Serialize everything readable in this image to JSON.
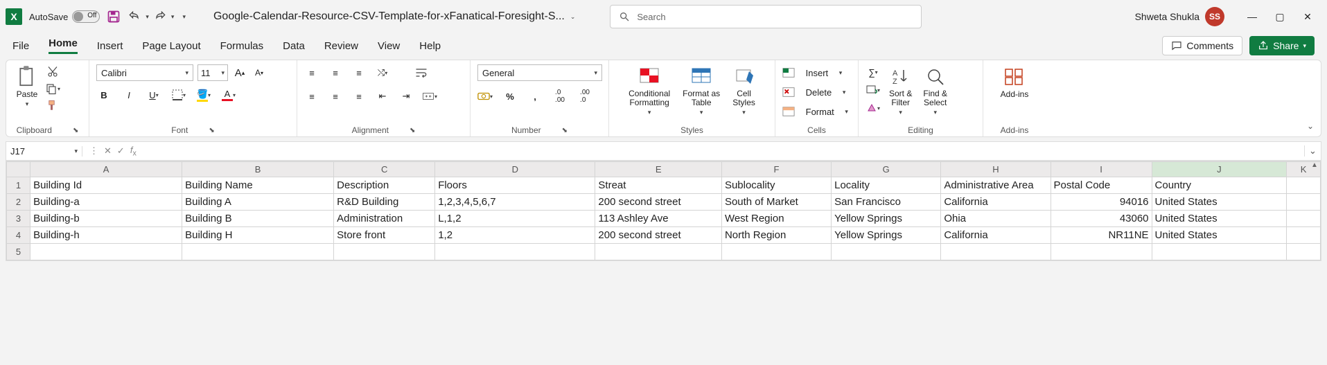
{
  "titlebar": {
    "autosave_label": "AutoSave",
    "autosave_state": "Off",
    "doc_title": "Google-Calendar-Resource-CSV-Template-for-xFanatical-Foresight-S...",
    "search_placeholder": "Search",
    "user_name": "Shweta Shukla",
    "user_initials": "SS"
  },
  "tabs": {
    "file": "File",
    "home": "Home",
    "insert": "Insert",
    "pagelayout": "Page Layout",
    "formulas": "Formulas",
    "data": "Data",
    "review": "Review",
    "view": "View",
    "help": "Help",
    "comments": "Comments",
    "share": "Share"
  },
  "ribbon": {
    "clipboard": {
      "paste": "Paste",
      "label": "Clipboard"
    },
    "font": {
      "name": "Calibri",
      "size": "11",
      "label": "Font"
    },
    "alignment": {
      "label": "Alignment"
    },
    "number": {
      "format": "General",
      "label": "Number"
    },
    "styles": {
      "conditional": "Conditional\nFormatting",
      "formatas": "Format as\nTable",
      "cellstyles": "Cell\nStyles",
      "label": "Styles"
    },
    "cells": {
      "insert": "Insert",
      "delete": "Delete",
      "format": "Format",
      "label": "Cells"
    },
    "editing": {
      "sortfilter": "Sort &\nFilter",
      "findselect": "Find &\nSelect",
      "label": "Editing"
    },
    "addins": {
      "btn": "Add-ins",
      "label": "Add-ins"
    }
  },
  "formulabar": {
    "namebox": "J17"
  },
  "grid": {
    "cols": [
      "A",
      "B",
      "C",
      "D",
      "E",
      "F",
      "G",
      "H",
      "I",
      "J",
      "K"
    ],
    "headers": [
      "Building Id",
      "Building Name",
      "Description",
      "Floors",
      "Streat",
      "Sublocality",
      "Locality",
      "Administrative Area",
      "Postal Code",
      "Country"
    ],
    "rows": [
      [
        "Building-a",
        "Building A",
        "R&D Building",
        "1,2,3,4,5,6,7",
        "200 second street",
        "South of Market",
        "San Francisco",
        "California",
        "94016",
        "United States"
      ],
      [
        "Building-b",
        "Building B",
        "Administration",
        "L,1,2",
        "113 Ashley Ave",
        "West Region",
        "Yellow Springs",
        "Ohia",
        "43060",
        "United States"
      ],
      [
        "Building-h",
        "Building H",
        "Store front",
        "1,2",
        "200 second street",
        "North Region",
        "Yellow Springs",
        "California",
        "NR11NE",
        "United States"
      ]
    ]
  }
}
